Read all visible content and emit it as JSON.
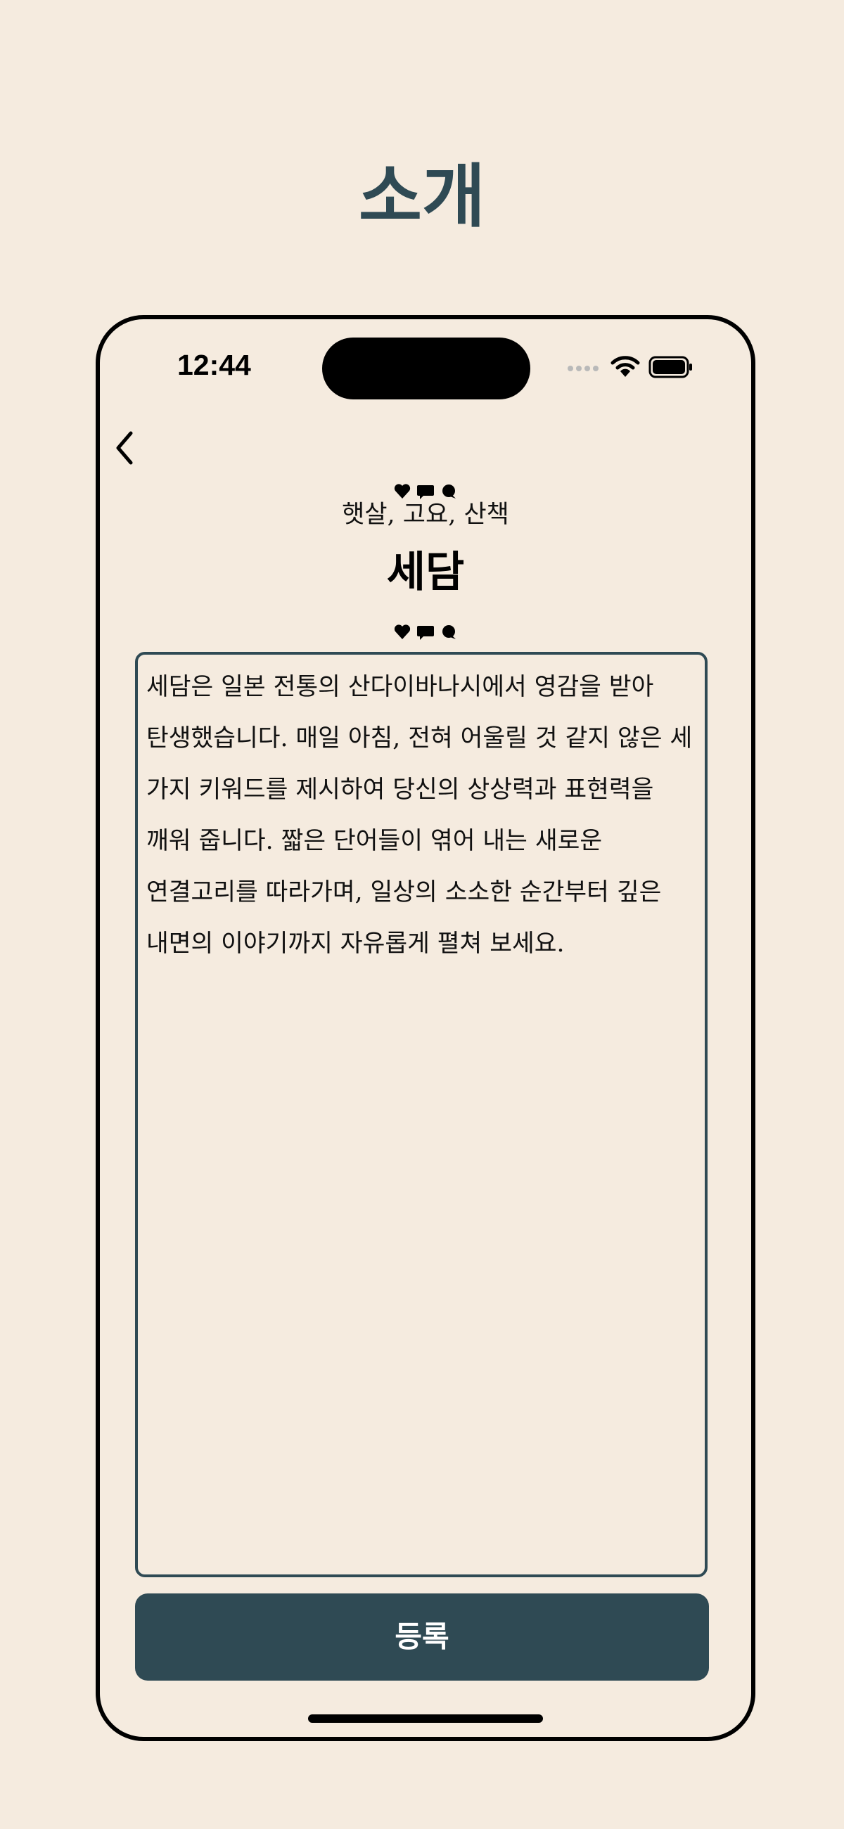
{
  "header": {
    "title": "소개"
  },
  "status_bar": {
    "time": "12:44"
  },
  "nav": {
    "back_icon": "chevron-left-icon"
  },
  "word_card": {
    "keywords": "햇살, 고요, 산책",
    "title": "세담",
    "decor_icons": [
      "heart-icon",
      "speech-bubble-icon",
      "chat-bubble-icon"
    ]
  },
  "intro": {
    "text": "세담은 일본 전통의 산다이바나시에서 영감을 받아 탄생했습니다. 매일 아침, 전혀 어울릴 것 같지 않은 세 가지 키워드를 제시하여 당신의 상상력과 표현력을 깨워 줍니다. 짧은 단어들이 엮어 내는 새로운 연결고리를 따라가며, 일상의 소소한 순간부터 깊은 내면의 이야기까지 자유롭게 펼쳐 보세요."
  },
  "actions": {
    "submit_label": "등록"
  },
  "colors": {
    "background": "#F5EBDF",
    "accent": "#2F4A54",
    "text": "#111111"
  }
}
